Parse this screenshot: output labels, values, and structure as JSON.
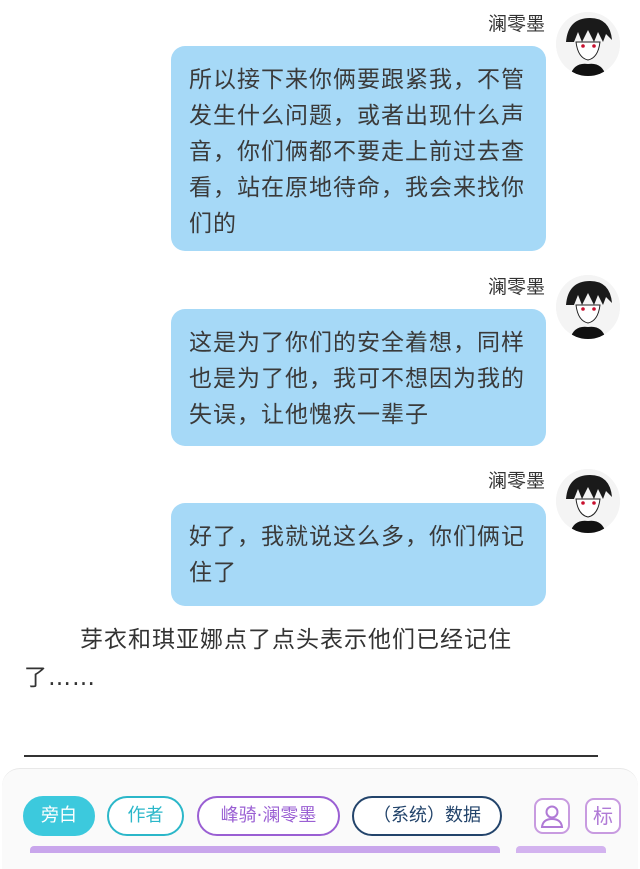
{
  "messages": [
    {
      "sender": "澜零墨",
      "text": "所以接下来你俩要跟紧我，不管发生什么问题，或者出现什么声音，你们俩都不要走上前过去查看，站在原地待命，我会来找你们的"
    },
    {
      "sender": "澜零墨",
      "text": "这是为了你们的安全着想，同样也是为了他，我可不想因为我的失误，让他愧疚一辈子"
    },
    {
      "sender": "澜零墨",
      "text": "好了，我就说这么多，你们俩记住了"
    }
  ],
  "narration": "芽衣和琪亚娜点了点头表示他们已经记住了……",
  "toolbar": {
    "chips": [
      "旁白",
      "作者",
      "峰骑·澜零墨",
      "（系统）数据"
    ],
    "tag_button": "标",
    "avatar_button_icon": "person-icon"
  },
  "colors": {
    "bubble": "#a6d9f7",
    "narrator_chip": "#3cc9dd",
    "author_chip": "#2bb7c9",
    "character_chip": "#9a5fd3",
    "system_chip": "#23446b"
  }
}
